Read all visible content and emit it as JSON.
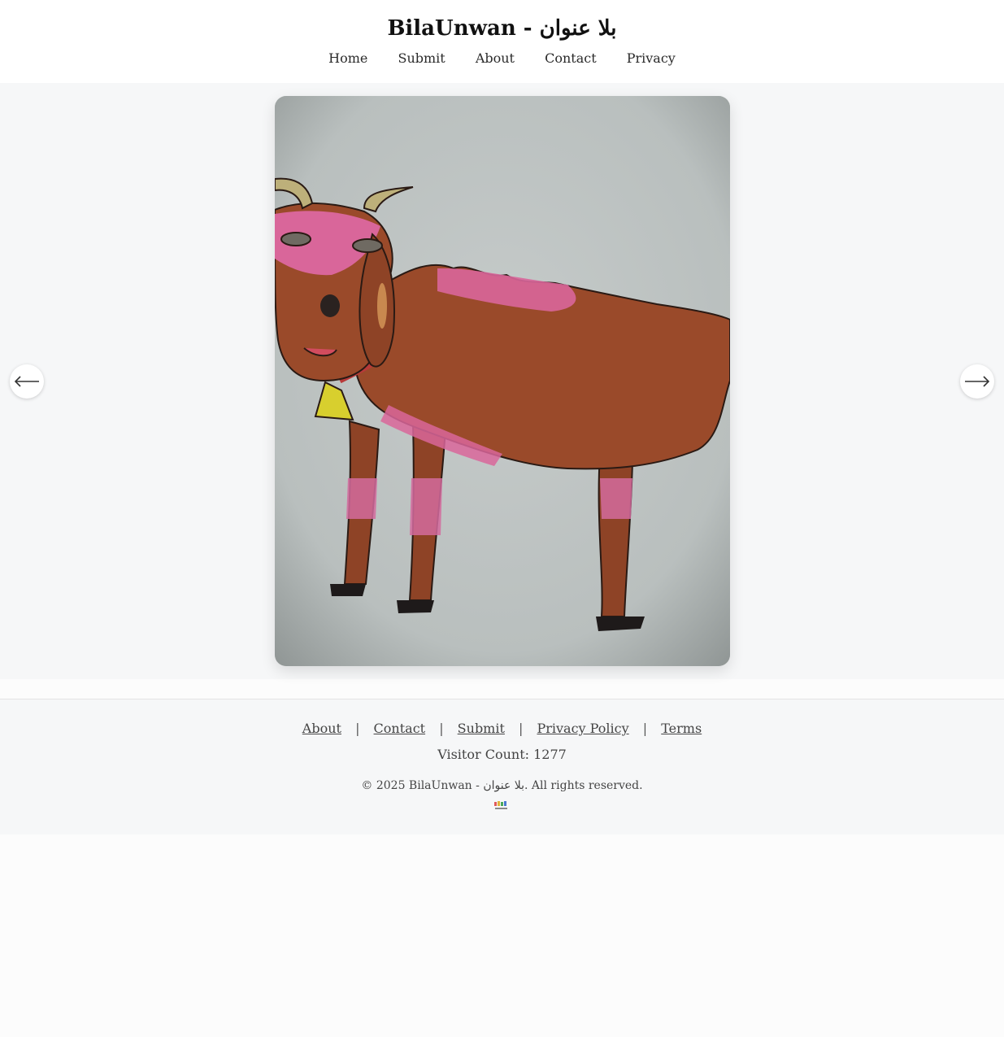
{
  "header": {
    "title": "BilaUnwan - بلا عنوان",
    "nav": [
      "Home",
      "Submit",
      "About",
      "Contact",
      "Privacy"
    ]
  },
  "gallery": {
    "prev_icon": "arrow-left-icon",
    "next_icon": "arrow-right-icon",
    "artwork_icon": "goat-drawing"
  },
  "footer": {
    "links": [
      "About",
      "Contact",
      "Submit",
      "Privacy Policy",
      "Terms"
    ],
    "separator": "|",
    "visitor_count": "Visitor Count: 1277",
    "copyright": "© 2025 BilaUnwan - بلا عنوان. All rights reserved.",
    "logo_icon": "bilaunwan-logo"
  },
  "colors": {
    "page_bg": "#fcfcfc",
    "gallery_bg": "#f6f7f8",
    "goat_body": "#9a4a2a",
    "goat_pink": "#d9669a",
    "bell": "#d8cf2e"
  }
}
